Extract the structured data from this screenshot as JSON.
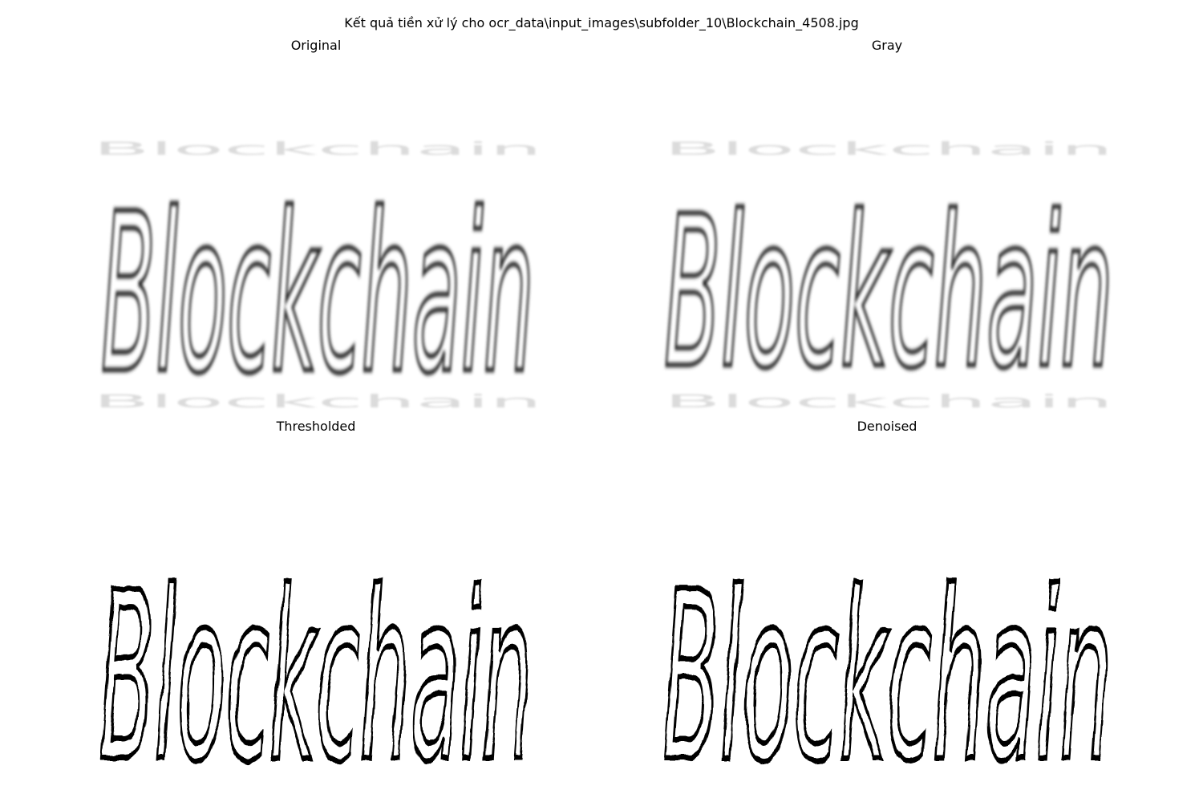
{
  "figure": {
    "suptitle": "Kết quả tiền xử lý cho ocr_data\\input_images\\subfolder_10\\Blockchain_4508.jpg"
  },
  "panels": [
    {
      "title": "Original",
      "word": "Blockchain",
      "style": "blurred-gray"
    },
    {
      "title": "Gray",
      "word": "Blockchain",
      "style": "blurred-gray"
    },
    {
      "title": "Thresholded",
      "word": "Blockchain",
      "style": "binary-black"
    },
    {
      "title": "Denoised",
      "word": "Blockchain",
      "style": "binary-black"
    }
  ],
  "colors": {
    "background": "#ffffff",
    "ink_gray": "#2b2b2b",
    "ink_black": "#000000",
    "ghost": "#d9d9d9"
  }
}
